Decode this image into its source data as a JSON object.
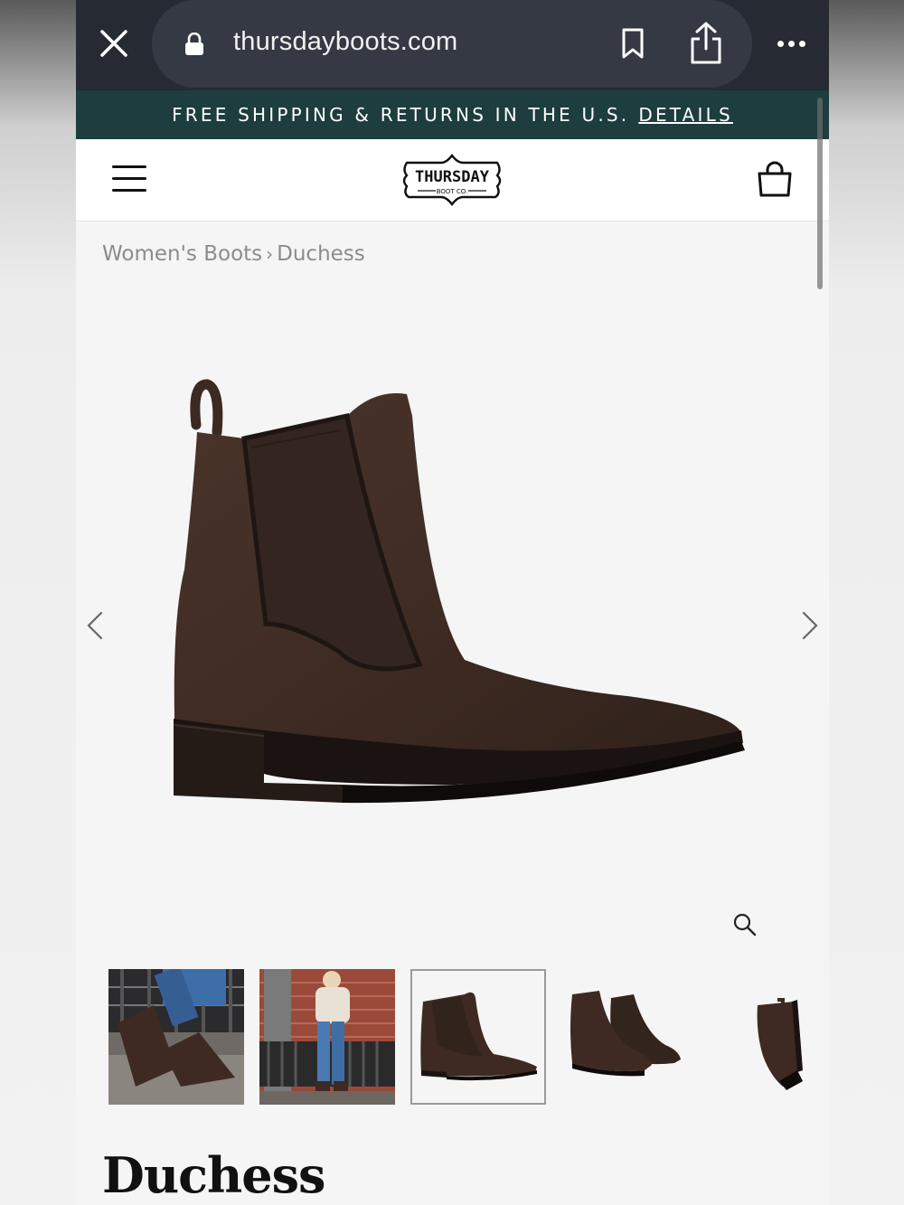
{
  "browser": {
    "url": "thursdayboots.com"
  },
  "promo": {
    "text": "FREE SHIPPING & RETURNS IN THE U.S.",
    "link": "DETAILS"
  },
  "header": {
    "logo_line1": "THURSDAY",
    "logo_line2": "BOOT CO."
  },
  "breadcrumb": {
    "parent": "Women's Boots",
    "current": "Duchess"
  },
  "gallery": {
    "thumbnails": [
      "lifestyle-steps",
      "lifestyle-street",
      "side-profile",
      "pair-angle",
      "back-view"
    ],
    "active_index": 2
  },
  "product": {
    "name": "Duchess",
    "color": "#3e2a22"
  }
}
